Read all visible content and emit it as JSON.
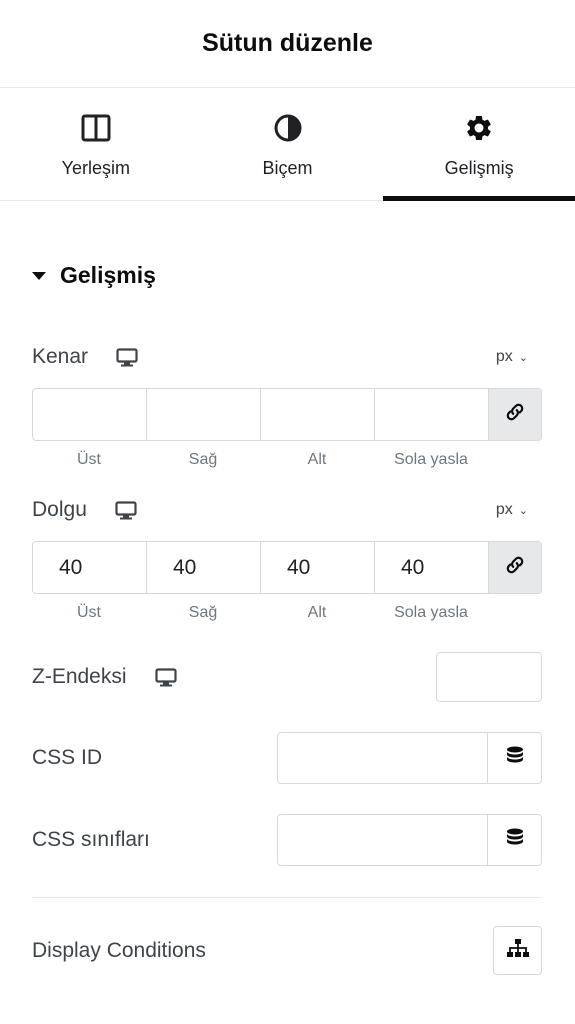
{
  "header": {
    "title": "Sütun düzenle"
  },
  "tabs": [
    {
      "label": "Yerleşim",
      "icon": "columns-layout-icon",
      "active": false
    },
    {
      "label": "Biçem",
      "icon": "contrast-icon",
      "active": false
    },
    {
      "label": "Gelişmiş",
      "icon": "gear-icon",
      "active": true
    }
  ],
  "section": {
    "title": "Gelişmiş",
    "expanded": true
  },
  "margin": {
    "label": "Kenar",
    "unit": "px",
    "values": [
      "",
      "",
      "",
      ""
    ],
    "sides": [
      "Üst",
      "Sağ",
      "Alt",
      "Sola yasla"
    ],
    "linked": true
  },
  "padding": {
    "label": "Dolgu",
    "unit": "px",
    "values": [
      "40",
      "40",
      "40",
      "40"
    ],
    "sides": [
      "Üst",
      "Sağ",
      "Alt",
      "Sola yasla"
    ],
    "linked": true
  },
  "z_index": {
    "label": "Z-Endeksi",
    "value": ""
  },
  "css_id": {
    "label": "CSS ID",
    "value": ""
  },
  "css_classes": {
    "label": "CSS sınıfları",
    "value": ""
  },
  "display_conditions": {
    "label": "Display Conditions"
  },
  "colors": {
    "text_dark": "#0c0d0e",
    "label": "#3f444b",
    "muted": "#6d7882",
    "border": "#d5d8dc",
    "link_bg": "#e6e8ea"
  }
}
